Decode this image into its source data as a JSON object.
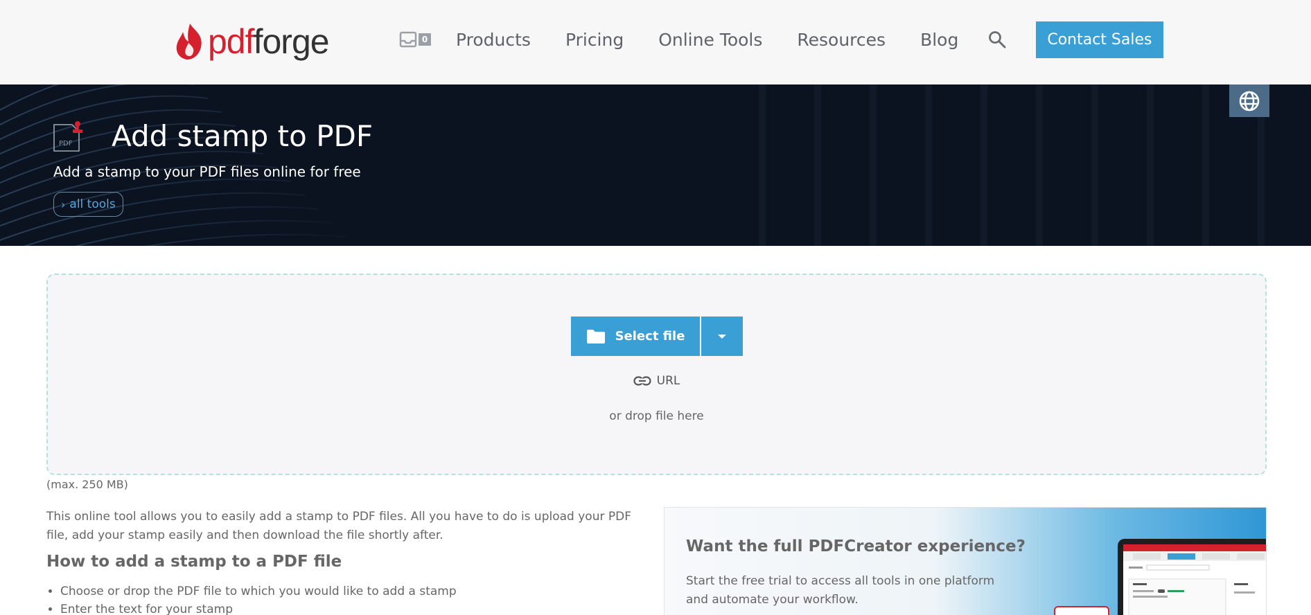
{
  "header": {
    "logo": {
      "part1": "pdf",
      "part2": "forge"
    },
    "inbox_count": "0",
    "nav": [
      "Products",
      "Pricing",
      "Online Tools",
      "Resources",
      "Blog"
    ],
    "contact": "Contact Sales"
  },
  "hero": {
    "icon_label": "PDF",
    "title": "Add stamp to PDF",
    "subtitle": "Add a stamp to your PDF files online for free",
    "all_tools": "all tools"
  },
  "dropzone": {
    "select_label": "Select file",
    "url_label": "URL",
    "drop_hint": "or drop file here",
    "max_size": "(max. 250 MB)"
  },
  "content": {
    "description": "This online tool allows you to easily add a stamp to PDF files. All you have to do is upload your PDF file, add your stamp easily and then download the file shortly after.",
    "how_title": "How to add a stamp to a PDF file",
    "steps": [
      "Choose or drop the PDF file to which you would like to add a stamp",
      "Enter the text for your stamp"
    ]
  },
  "promo": {
    "title": "Want the full PDFCreator experience?",
    "text": "Start the free trial to access all tools in one platform and automate your workflow."
  },
  "colors": {
    "accent": "#3a9fd5",
    "brand_red": "#d5202d",
    "hero_bg": "#0b1220",
    "dropzone_border": "#b6e0df"
  },
  "icons": [
    "inbox-icon",
    "search-icon",
    "globe-icon",
    "pdf-stamp-icon",
    "folder-icon",
    "caret-down-icon",
    "link-icon",
    "chevron-right-icon"
  ]
}
